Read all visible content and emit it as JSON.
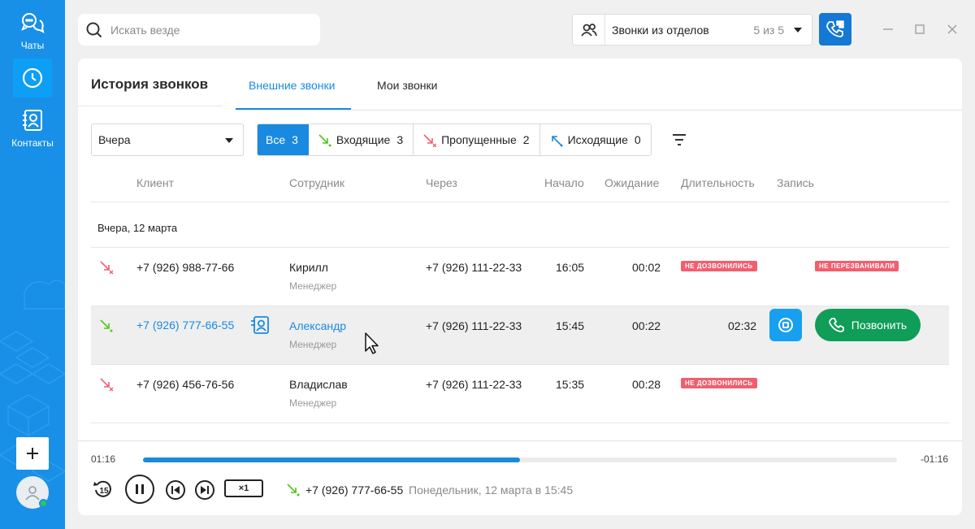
{
  "sidebar": {
    "chats_label": "Чаты",
    "contacts_label": "Контакты"
  },
  "search": {
    "placeholder": "Искать везде"
  },
  "departments": {
    "label": "Звонки из отделов",
    "count": "5 из 5"
  },
  "header": {
    "title": "История звонков",
    "tabs": [
      {
        "label": "Внешние звонки"
      },
      {
        "label": "Мои звонки"
      }
    ]
  },
  "filters": {
    "period": "Вчера",
    "segments": [
      {
        "label": "Все",
        "count": "3"
      },
      {
        "label": "Входящие",
        "count": "3"
      },
      {
        "label": "Пропущенные",
        "count": "2"
      },
      {
        "label": "Исходящие",
        "count": "0"
      }
    ]
  },
  "table": {
    "columns": [
      "Клиент",
      "Сотрудник",
      "Через",
      "Начало",
      "Ожидание",
      "Длительность",
      "Запись"
    ],
    "group": "Вчера, 12 марта",
    "rows": [
      {
        "direction": "missed",
        "client": "+7 (926) 988-77-66",
        "employee": "Кирилл",
        "role": "Менеджер",
        "via": "+7 (926) 111-22-33",
        "start": "16:05",
        "wait": "00:02",
        "status_badge": "НЕ ДОЗВОНИЛИСЬ",
        "record_badge": "НЕ ПЕРЕЗВАНИВАЛИ"
      },
      {
        "direction": "incoming",
        "client": "+7 (926) 777-66-55",
        "employee": "Александр",
        "role": "Менеджер",
        "via": "+7 (926) 111-22-33",
        "start": "15:45",
        "wait": "00:22",
        "duration": "02:32",
        "call_label": "Позвонить"
      },
      {
        "direction": "missed",
        "client": "+7 (926) 456-76-56",
        "employee": "Владислав",
        "role": "Менеджер",
        "via": "+7 (926) 111-22-33",
        "start": "15:35",
        "wait": "00:28",
        "status_badge": "НЕ ДОЗВОНИЛИСЬ"
      }
    ]
  },
  "player": {
    "elapsed": "01:16",
    "remaining": "-01:16",
    "progress": 0.5,
    "speed": "×1",
    "rewind": "15",
    "number": "+7 (926) 777-66-55",
    "datetime": "Понедельник, 12 марта в 15:45"
  },
  "colors": {
    "accent": "#1a8ae0",
    "sidebar": "#1890e8",
    "missed": "#f15f6f",
    "incoming": "#52c41a",
    "call": "#0f9d58"
  }
}
